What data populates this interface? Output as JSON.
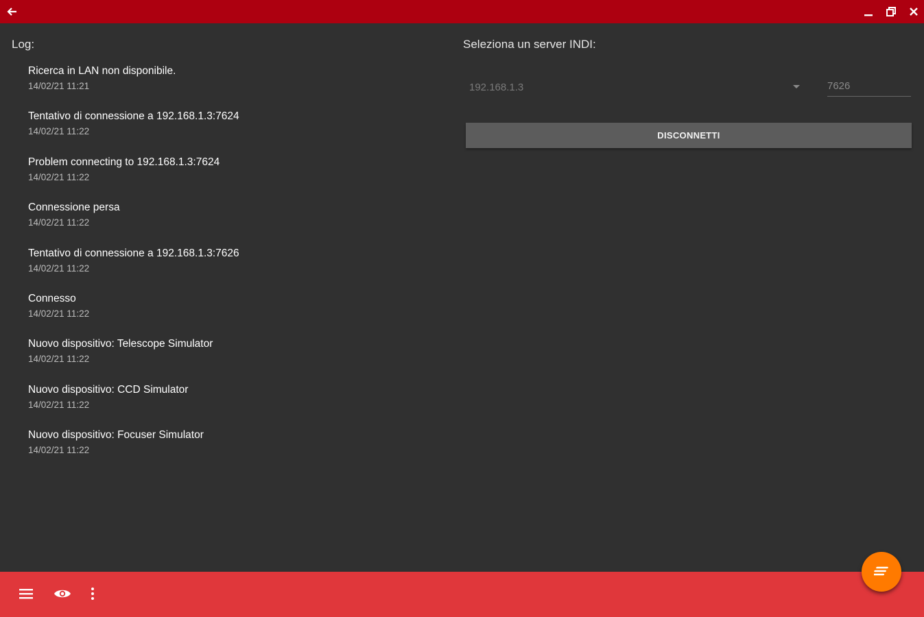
{
  "titlebar": {
    "back_icon": "arrow-left-icon",
    "minimize_icon": "minimize-icon",
    "restore_icon": "restore-icon",
    "close_icon": "close-icon",
    "color": "#ad0010"
  },
  "log": {
    "title": "Log:",
    "entries": [
      {
        "message": "Ricerca in LAN non disponibile.",
        "time": "14/02/21 11:21"
      },
      {
        "message": "Tentativo di connessione a 192.168.1.3:7624",
        "time": "14/02/21 11:22"
      },
      {
        "message": "Problem connecting to 192.168.1.3:7624",
        "time": "14/02/21 11:22"
      },
      {
        "message": "Connessione persa",
        "time": "14/02/21 11:22"
      },
      {
        "message": "Tentativo di connessione a 192.168.1.3:7626",
        "time": "14/02/21 11:22"
      },
      {
        "message": "Connesso",
        "time": "14/02/21 11:22"
      },
      {
        "message": "Nuovo dispositivo: Telescope Simulator",
        "time": "14/02/21 11:22"
      },
      {
        "message": "Nuovo dispositivo: CCD Simulator",
        "time": "14/02/21 11:22"
      },
      {
        "message": "Nuovo dispositivo: Focuser Simulator",
        "time": "14/02/21 11:22"
      }
    ]
  },
  "server": {
    "title": "Seleziona un server INDI:",
    "host_value": "192.168.1.3",
    "port_value": "7626",
    "disconnect_label": "DISCONNETTI"
  },
  "bottombar": {
    "menu_icon": "menu-icon",
    "eye_icon": "eye-icon",
    "more_icon": "more-vert-icon",
    "color": "#e0373b"
  },
  "fab": {
    "icon": "notes-icon",
    "color": "#ff7a00"
  }
}
